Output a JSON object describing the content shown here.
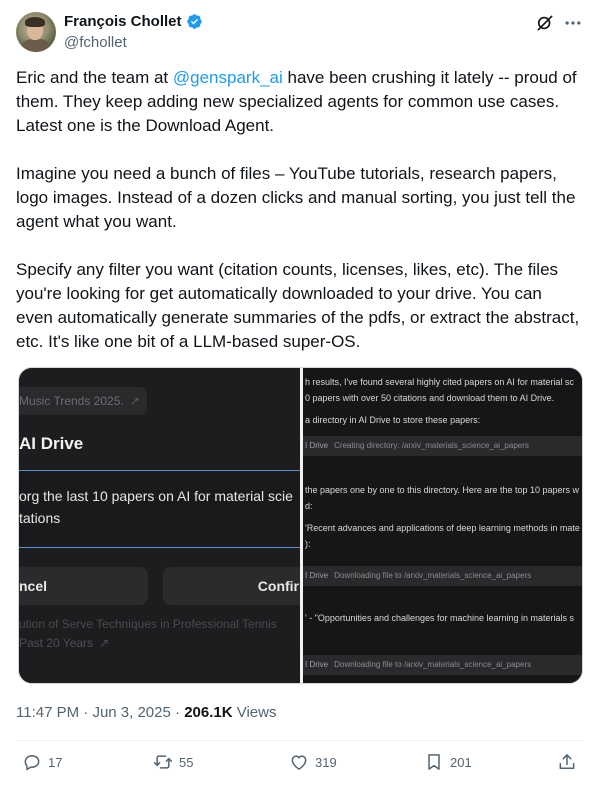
{
  "author": {
    "name": "François Chollet",
    "handle": "@fchollet"
  },
  "icons": {
    "verified": "verified-badge-icon",
    "grok": "grok-icon",
    "more": "more-icon",
    "reply": "reply-icon",
    "retweet": "retweet-icon",
    "like": "like-icon",
    "bookmark": "bookmark-icon",
    "share": "share-icon"
  },
  "colors": {
    "accent": "#1d9bf0",
    "text": "#0f1419",
    "secondary": "#536471"
  },
  "tweet": {
    "p1_before": "Eric and the team at ",
    "p1_mention": "@genspark_ai",
    "p1_after": " have been crushing it lately -- proud of them. They keep adding new specialized agents for common use cases. Latest one is the Download Agent.",
    "p2": "Imagine you need a bunch of files – YouTube tutorials, research papers, logo images. Instead of a dozen clicks and manual sorting, you just tell the agent what you want.",
    "p3": "Specify any filter you want (citation counts, licenses, likes, etc). The files you're looking for get automatically downloaded to your drive. You can even automatically generate summaries of the pdfs, or extract the abstract, etc. It's like one bit of a LLM-based super-OS."
  },
  "media": {
    "left": {
      "trend_chip": "Music Trends 2025.",
      "dialog_title": "AI Drive",
      "input_line1": "org the last 10 papers on AI for material scie",
      "input_line2": "tations",
      "cancel": "ncel",
      "confirm": "Confir",
      "bg_line1": "ution of Serve Techniques in Professional Tennis",
      "bg_line2": "Past 20 Years"
    },
    "right": {
      "line1": "h results, I've found several highly cited papers on AI for material sc",
      "line2": "0 papers with over 50 citations and download them to AI Drive.",
      "line3": "a directory in AI Drive to store these papers:",
      "bar1_label": "I Drive",
      "bar1_text": "Creating directory: /arxiv_materials_science_ai_papers",
      "line4": "the papers one by one to this directory. Here are the top 10 papers w",
      "line5": "d:",
      "line6": "'Recent advances and applications of deep learning methods in mate",
      "line7": "):",
      "bar2_label": "I Drive",
      "bar2_text": "Downloading file to /arxiv_materials_science_ai_papers",
      "line8": "' - \"Opportunities and challenges for machine learning in materials s",
      "bar3_label": "I Drive",
      "bar3_text": "Downloading file to /arxiv_materials_science_ai_papers"
    }
  },
  "meta": {
    "time": "11:47 PM",
    "dot1": " · ",
    "date": "Jun 3, 2025",
    "dot2": " · ",
    "views_count": "206.1K",
    "views_label": " Views"
  },
  "stats": {
    "replies": "17",
    "retweets": "55",
    "likes": "319",
    "bookmarks": "201"
  }
}
